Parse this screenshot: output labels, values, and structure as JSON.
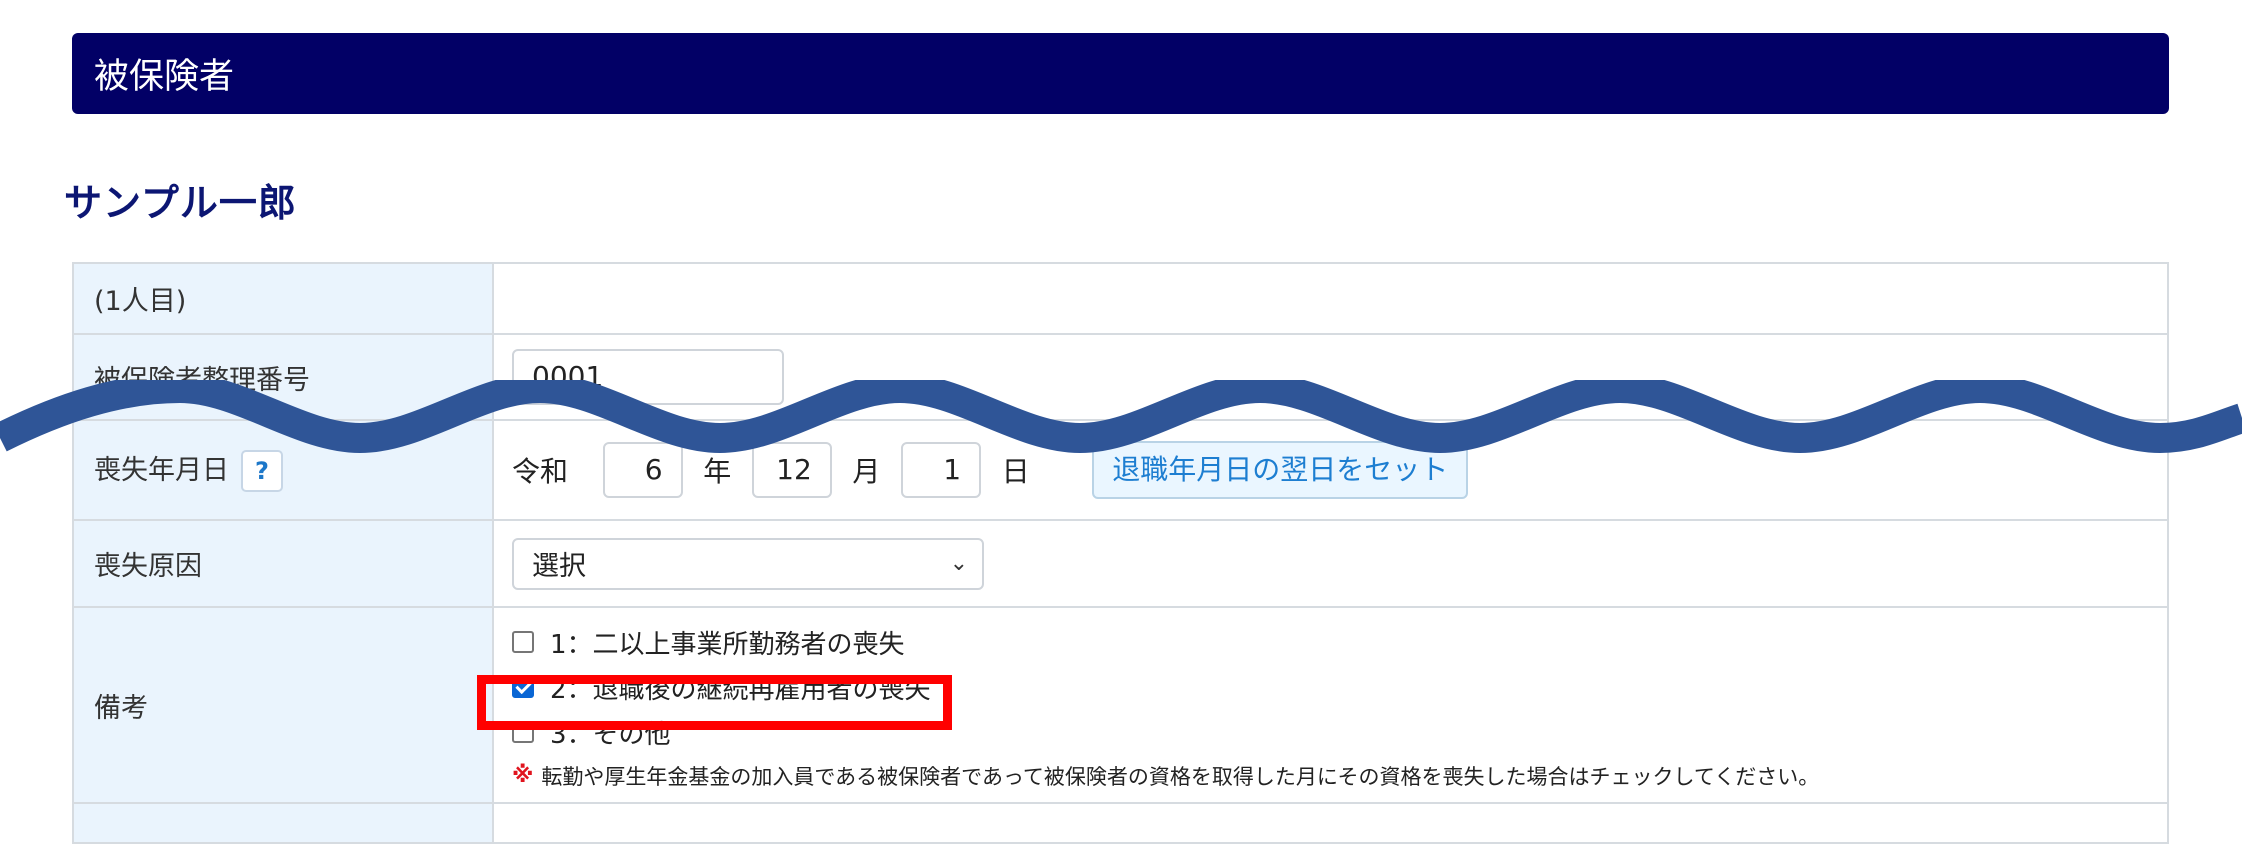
{
  "section_title": "被保険者",
  "person_name": "サンプル一郎",
  "rows": {
    "person_index": {
      "label": "(1人目)"
    },
    "insured_number": {
      "label": "被保険者整理番号",
      "value": "0001"
    },
    "loss_date": {
      "label": "喪失年月日",
      "help": "?",
      "era": "令和",
      "year": "6",
      "year_unit": "年",
      "month": "12",
      "month_unit": "月",
      "day": "1",
      "day_unit": "日",
      "set_button": "退職年月日の翌日をセット"
    },
    "loss_reason": {
      "label": "喪失原因",
      "selected": "選択"
    },
    "remarks": {
      "label": "備考",
      "options": [
        {
          "label": "1：二以上事業所勤務者の喪失",
          "checked": false
        },
        {
          "label": "2：退職後の継続再雇用者の喪失",
          "checked": true
        },
        {
          "label": "3：その他",
          "checked": false
        }
      ],
      "note_mark": "※",
      "note": "転勤や厚生年金基金の加入員である被保険者であって被保険者の資格を取得した月にその資格を喪失した場合はチェックしてください。"
    }
  },
  "colors": {
    "header_bg": "#020066",
    "name": "#0c1673",
    "highlight": "#ff0000",
    "wave": "#2f5597"
  }
}
